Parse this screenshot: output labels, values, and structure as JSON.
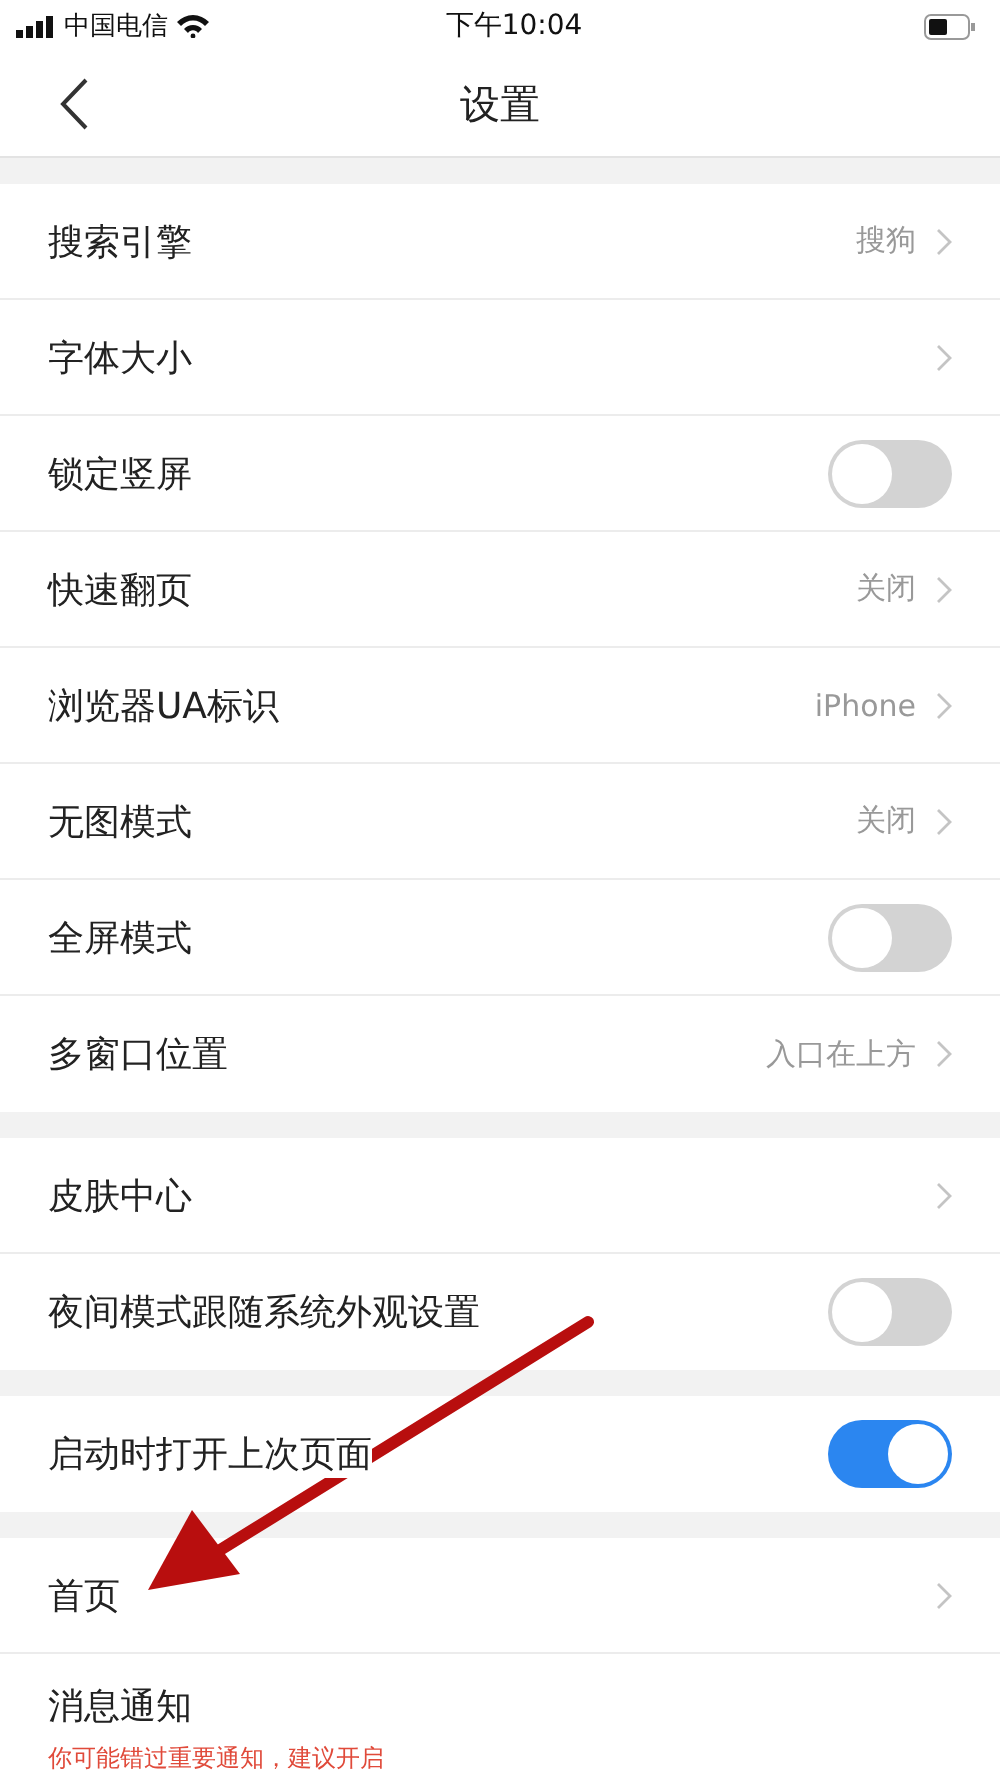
{
  "status_bar": {
    "carrier": "中国电信",
    "time": "下午10:04"
  },
  "nav": {
    "title": "设置"
  },
  "groups": [
    {
      "rows": [
        {
          "kind": "link",
          "label": "搜索引擎",
          "value": "搜狗"
        },
        {
          "kind": "link",
          "label": "字体大小"
        },
        {
          "kind": "toggle",
          "label": "锁定竖屏",
          "on": false
        },
        {
          "kind": "link",
          "label": "快速翻页",
          "value": "关闭"
        },
        {
          "kind": "link",
          "label": "浏览器UA标识",
          "value": "iPhone"
        },
        {
          "kind": "link",
          "label": "无图模式",
          "value": "关闭"
        },
        {
          "kind": "toggle",
          "label": "全屏模式",
          "on": false
        },
        {
          "kind": "link",
          "label": "多窗口位置",
          "value": "入口在上方"
        }
      ]
    },
    {
      "rows": [
        {
          "kind": "link",
          "label": "皮肤中心"
        },
        {
          "kind": "toggle",
          "label": "夜间模式跟随系统外观设置",
          "on": false
        }
      ]
    },
    {
      "rows": [
        {
          "kind": "toggle",
          "label": "启动时打开上次页面",
          "on": true
        }
      ]
    },
    {
      "rows": [
        {
          "kind": "link",
          "label": "首页"
        },
        {
          "kind": "plain",
          "label": "消息通知",
          "note": "你可能错过重要通知，建议开启"
        }
      ]
    }
  ]
}
